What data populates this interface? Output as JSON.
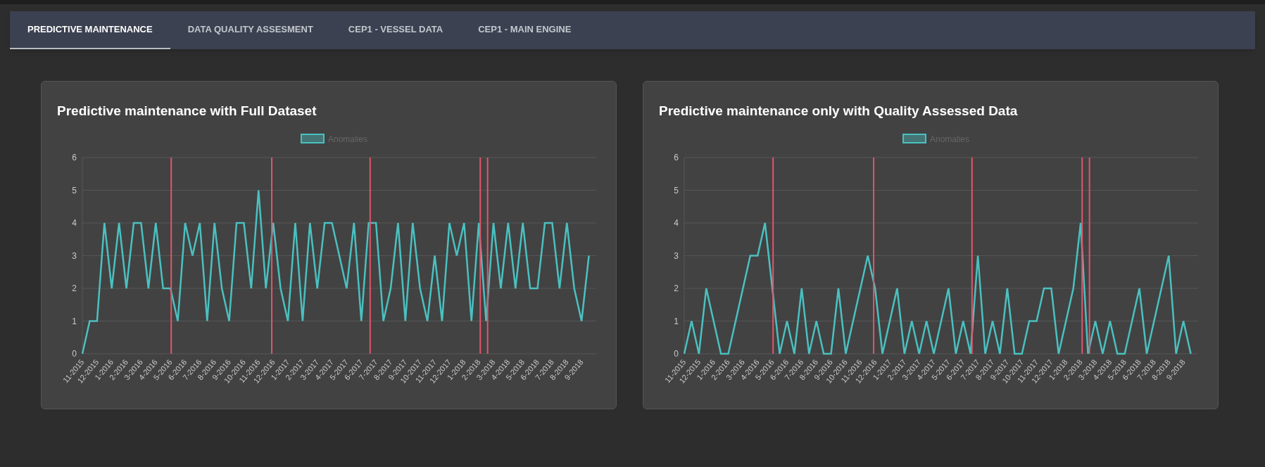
{
  "tabs": [
    {
      "label": "PREDICTIVE MAINTENANCE",
      "selected": true
    },
    {
      "label": "DATA QUALITY ASSESMENT",
      "selected": false
    },
    {
      "label": "CEP1 - VESSEL DATA",
      "selected": false
    },
    {
      "label": "CEP1 - MAIN ENGINE",
      "selected": false
    }
  ],
  "panels": [
    {
      "title": "Predictive maintenance with Full Dataset",
      "chart_data": {
        "type": "line",
        "categories": [
          "11-2015",
          null,
          "12-2015",
          null,
          "1-2016",
          null,
          "2-2016",
          null,
          "3-2016",
          null,
          "4-2016",
          null,
          "5-2016",
          null,
          "6-2016",
          null,
          "7-2016",
          null,
          "8-2016",
          null,
          "9-2016",
          null,
          "10-2016",
          null,
          "11-2016",
          null,
          "12-2016",
          null,
          "1-2017",
          null,
          "2-2017",
          null,
          "3-2017",
          null,
          "4-2017",
          null,
          "5-2017",
          null,
          "6-2017",
          null,
          "7-2017",
          null,
          "8-2017",
          null,
          "9-2017",
          null,
          "10-2017",
          null,
          "11-2017",
          null,
          "12-2017",
          null,
          "1-2018",
          null,
          "2-2018",
          null,
          "3-2018",
          null,
          "4-2018",
          null,
          "5-2018",
          null,
          "6-2018",
          null,
          "7-2018",
          null,
          "8-2018",
          null,
          "9-2018",
          null
        ],
        "ylim": [
          0,
          6
        ],
        "yticks": [
          0,
          1,
          2,
          3,
          4,
          5,
          6
        ],
        "series": [
          {
            "name": "Anomalies",
            "color": "#4bc0c0",
            "values": [
              0,
              1,
              1,
              4,
              2,
              4,
              2,
              4,
              4,
              2,
              4,
              2,
              2,
              1,
              4,
              3,
              4,
              1,
              4,
              2,
              1,
              4,
              4,
              2,
              5,
              2,
              4,
              2,
              1,
              4,
              1,
              4,
              2,
              4,
              4,
              3,
              2,
              4,
              1,
              4,
              4,
              1,
              2,
              4,
              1,
              4,
              2,
              1,
              3,
              1,
              4,
              3,
              4,
              1,
              4,
              1,
              4,
              2,
              4,
              2,
              4,
              2,
              2,
              4,
              4,
              2,
              4,
              2,
              1,
              3
            ]
          }
        ],
        "grid": true
      }
    },
    {
      "title": "Predictive maintenance only with Quality Assessed Data",
      "chart_data": {
        "type": "line",
        "categories": [
          "11-2015",
          null,
          "12-2015",
          null,
          "1-2016",
          null,
          "2-2016",
          null,
          "3-2016",
          null,
          "4-2016",
          null,
          "5-2016",
          null,
          "6-2016",
          null,
          "7-2016",
          null,
          "8-2016",
          null,
          "9-2016",
          null,
          "10-2016",
          null,
          "11-2016",
          null,
          "12-2016",
          null,
          "1-2017",
          null,
          "2-2017",
          null,
          "3-2017",
          null,
          "4-2017",
          null,
          "5-2017",
          null,
          "6-2017",
          null,
          "7-2017",
          null,
          "8-2017",
          null,
          "9-2017",
          null,
          "10-2017",
          null,
          "11-2017",
          null,
          "12-2017",
          null,
          "1-2018",
          null,
          "2-2018",
          null,
          "3-2018",
          null,
          "4-2018",
          null,
          "5-2018",
          null,
          "6-2018",
          null,
          "7-2018",
          null,
          "8-2018",
          null,
          "9-2018",
          null
        ],
        "ylim": [
          0,
          6
        ],
        "yticks": [
          0,
          1,
          2,
          3,
          4,
          5,
          6
        ],
        "series": [
          {
            "name": "Anomalies",
            "color": "#4bc0c0",
            "values": [
              0,
              1,
              0,
              2,
              1,
              0,
              0,
              1,
              2,
              3,
              3,
              4,
              2,
              0,
              1,
              0,
              2,
              0,
              1,
              0,
              0,
              2,
              0,
              1,
              2,
              3,
              2,
              0,
              1,
              2,
              0,
              1,
              0,
              1,
              0,
              1,
              2,
              0,
              1,
              0,
              3,
              0,
              1,
              0,
              2,
              0,
              0,
              1,
              1,
              2,
              2,
              0,
              1,
              2,
              4,
              0,
              1,
              0,
              1,
              0,
              0,
              1,
              2,
              0,
              1,
              2,
              3,
              0,
              1,
              0
            ]
          }
        ],
        "grid": true
      }
    }
  ]
}
